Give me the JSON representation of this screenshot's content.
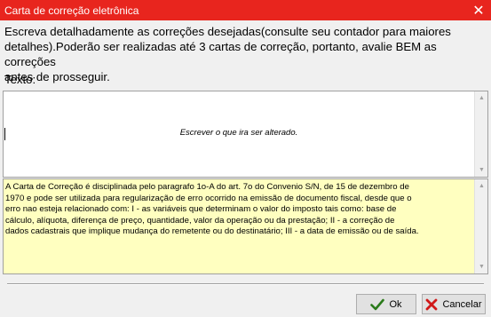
{
  "window": {
    "title": "Carta de correção eletrônica",
    "close_glyph": "✕"
  },
  "instructions": {
    "line1": "Escreva detalhadamente as correções desejadas(consulte seu contador para maiores",
    "line2": "detalhes).Poderão ser realizadas até 3 cartas de correção, portanto, avalie BEM as correções",
    "line3": "antes de prosseguir."
  },
  "texto": {
    "label": "Texto:",
    "placeholder": "Escrever o que ira ser alterado.",
    "value": ""
  },
  "info": {
    "lines": [
      "A Carta de Correção é disciplinada pelo paragrafo 1o-A do art. 7o do Convenio S/N, de 15 de dezembro de",
      "1970 e pode ser utilizada para regularização de erro ocorrido na emissão de documento fiscal, desde que o",
      "erro nao esteja relacionado com: I - as variáveis que determinam o valor do imposto tais como: base de",
      "cálculo, alíquota, diferença de preço, quantidade, valor da operação ou da prestação; II - a correção de",
      "dados cadastrais que implique mudança do remetente ou do destinatário; III - a data de emissão ou de saída."
    ],
    "background": "#ffffc0"
  },
  "buttons": {
    "ok_label": "Ok",
    "cancel_label": "Cancelar"
  },
  "colors": {
    "titlebar": "#e8251e",
    "ok_icon": "#2a7a1a",
    "cancel_icon": "#d01818"
  },
  "icons": {
    "ok": "checkmark-icon",
    "cancel": "cross-icon"
  }
}
